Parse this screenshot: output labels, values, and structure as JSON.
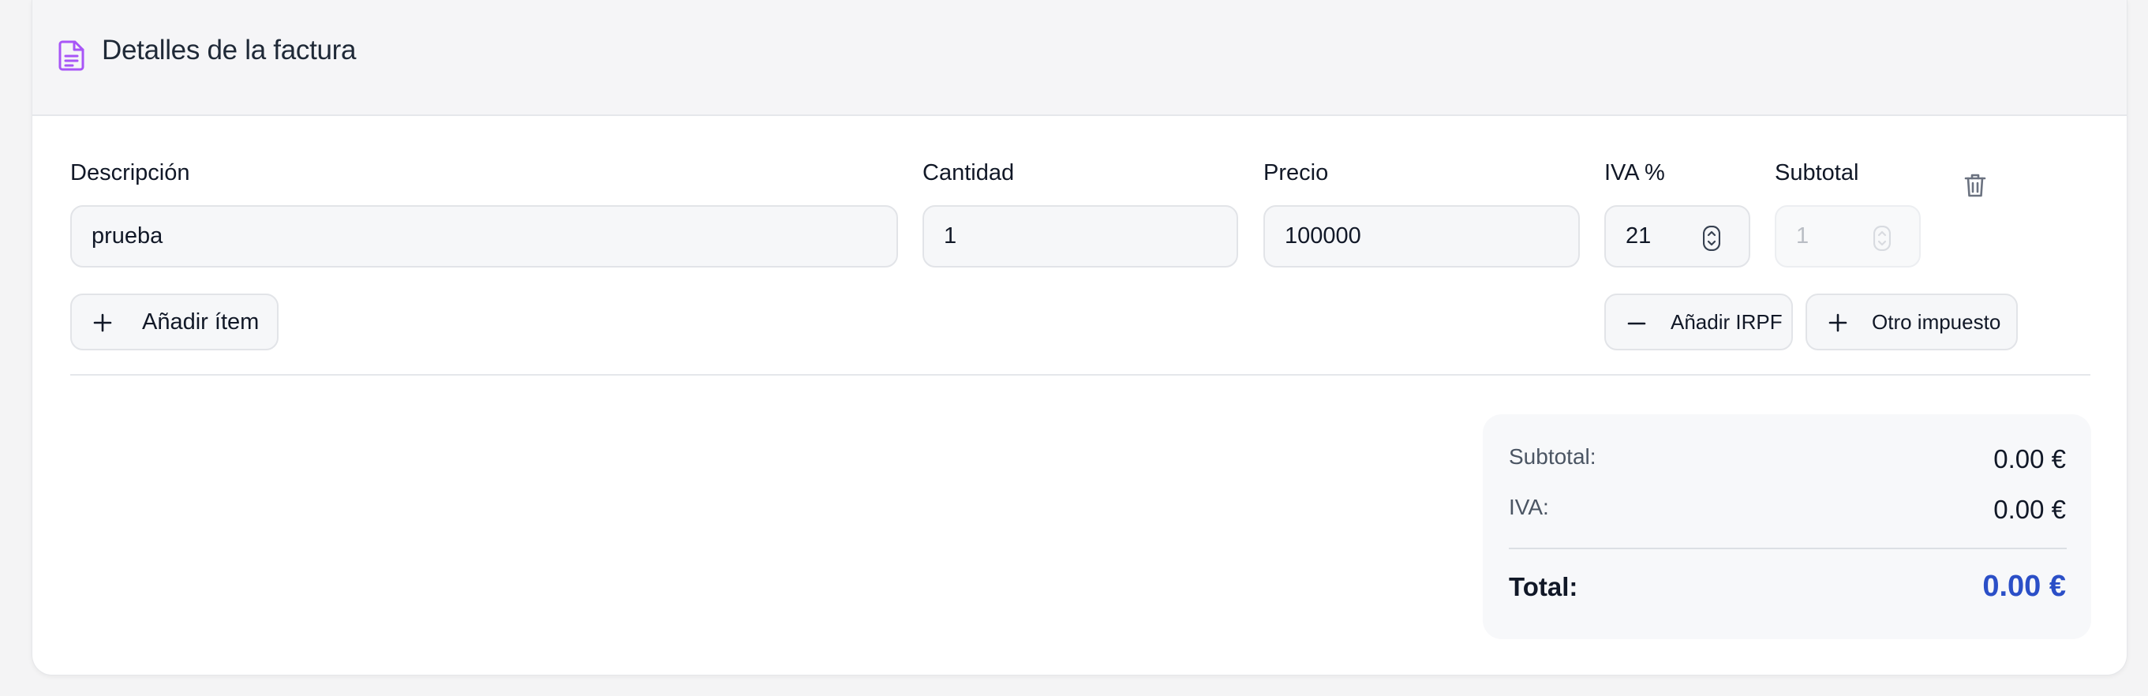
{
  "header": {
    "title": "Detalles de la factura",
    "icon": "document-icon",
    "icon_color": "#a855f7"
  },
  "item_form": {
    "labels": {
      "description": "Descripción",
      "quantity": "Cantidad",
      "price": "Precio",
      "vat": "IVA %",
      "subtotal": "Subtotal"
    },
    "values": {
      "description": "prueba",
      "quantity": "1",
      "price": "100000",
      "vat": "21",
      "subtotal": "1"
    },
    "delete_icon": "trash-icon"
  },
  "actions": {
    "add_item": "Añadir ítem",
    "add_irpf": "Añadir IRPF",
    "other_tax": "Otro impuesto"
  },
  "summary": {
    "subtotal_label": "Subtotal:",
    "subtotal_value": "0.00 €",
    "vat_label": "IVA:",
    "vat_value": "0.00 €",
    "total_label": "Total:",
    "total_value": "0.00 €",
    "total_color": "#2b4fc7"
  }
}
